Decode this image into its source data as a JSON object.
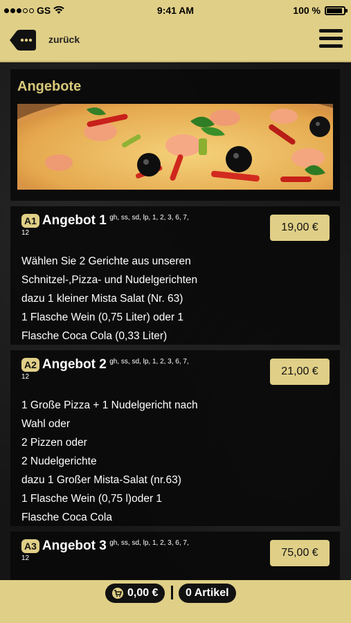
{
  "status_bar": {
    "carrier": "GS",
    "time": "9:41 AM",
    "battery_pct": "100 %",
    "battery_level": 1.0,
    "signal_dots_filled": 3,
    "signal_dots_total": 5
  },
  "nav": {
    "back_label": "zurück",
    "back_icon": "back-tag-icon",
    "menu_icon": "hamburger-menu-icon"
  },
  "section": {
    "title": "Angebote"
  },
  "offers": [
    {
      "badge": "A1",
      "name": "Angebot 1",
      "allergens_line1": "gh, ss, sd, lp, 1, 2, 3, 6, 7,",
      "allergens_line2": "12",
      "price": "19,00 €",
      "lines": [
        "Wählen Sie 2 Gerichte aus unseren",
        "Schnitzel-,Pizza- und Nudelgerichten",
        "dazu 1 kleiner Mista Salat (Nr. 63)",
        "1 Flasche Wein (0,75 Liter) oder 1",
        "Flasche Coca Cola (0,33 Liter)"
      ]
    },
    {
      "badge": "A2",
      "name": "Angebot 2",
      "allergens_line1": "gh, ss, sd, lp, 1, 2, 3, 6, 7,",
      "allergens_line2": "12",
      "price": "21,00 €",
      "lines": [
        "1 Große Pizza + 1 Nudelgericht nach",
        "Wahl oder",
        "2 Pizzen oder",
        "2 Nudelgerichte",
        "dazu 1 Großer Mista-Salat (nr.63)",
        "1 Flasche Wein (0,75 l)oder 1",
        "Flasche Coca Cola"
      ]
    },
    {
      "badge": "A3",
      "name": "Angebot 3",
      "allergens_line1": "gh, ss, sd, lp, 1, 2, 3, 6, 7,",
      "allergens_line2": "12",
      "price": "75,00 €",
      "lines": []
    }
  ],
  "cart": {
    "total": "0,00 €",
    "items": "0 Artikel",
    "icon": "cart-icon"
  },
  "colors": {
    "accent": "#e0cf87",
    "title": "#d8c87a",
    "background": "#151515"
  }
}
